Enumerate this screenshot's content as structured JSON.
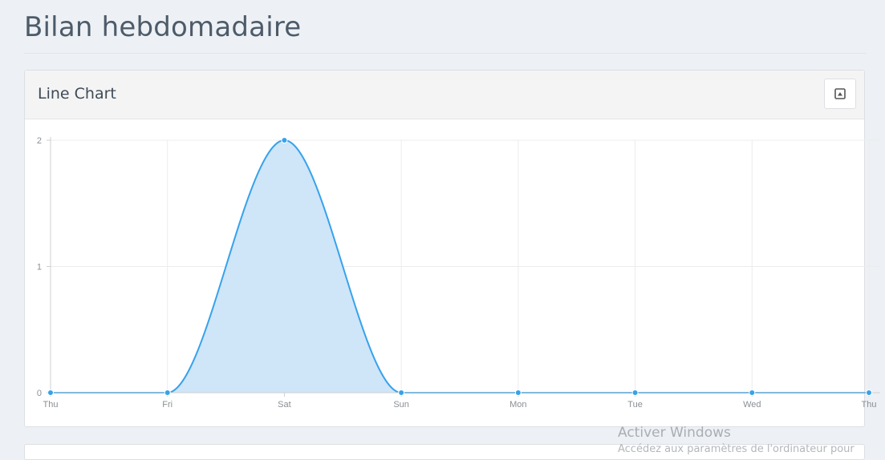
{
  "page": {
    "title": "Bilan hebdomadaire"
  },
  "panel": {
    "title": "Line Chart",
    "tool_icon": "collapse-icon"
  },
  "chart_data": {
    "type": "area",
    "title": "",
    "xlabel": "",
    "ylabel": "",
    "categories": [
      "Thu",
      "Fri",
      "Sat",
      "Sun",
      "Mon",
      "Tue",
      "Wed",
      "Thu"
    ],
    "series": [
      {
        "values": [
          0,
          0,
          2,
          0,
          0,
          0,
          0,
          0
        ]
      }
    ],
    "yticks": [
      0,
      1,
      2
    ],
    "ylim": [
      0,
      2
    ],
    "grid": true,
    "legend": "none",
    "colors": {
      "line": "#36a2eb",
      "fill": "#cfe5f8",
      "grid": "#ececec",
      "axis": "#cfcfcf"
    }
  },
  "watermark": {
    "title": "Activer Windows",
    "subtitle": "Accédez aux paramètres de l'ordinateur pour"
  }
}
